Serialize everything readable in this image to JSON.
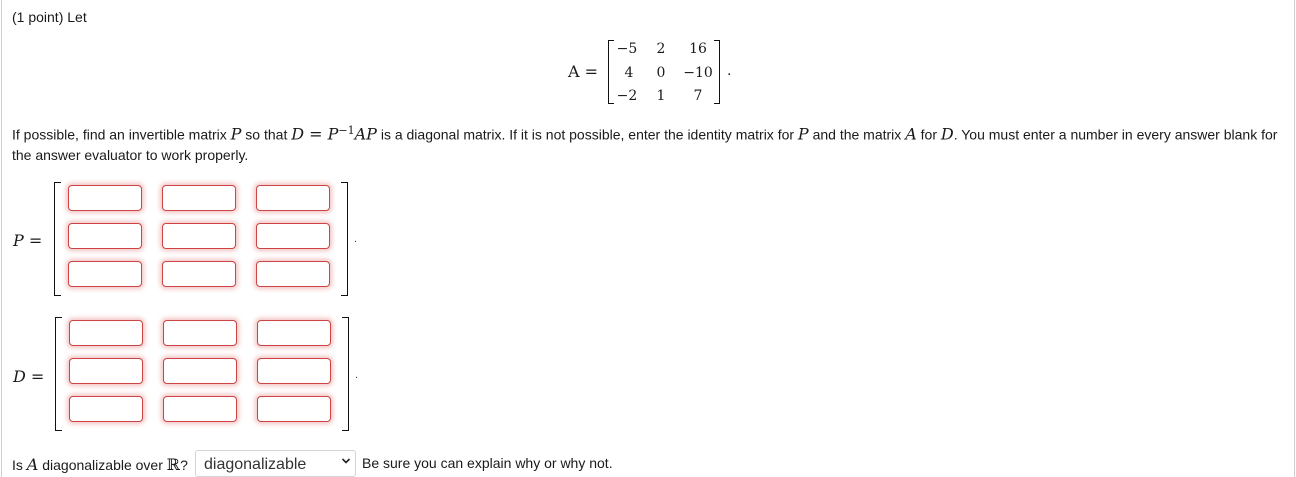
{
  "heading": "(1 point) Let",
  "matrix_a": {
    "label": "A =",
    "rows": [
      [
        "−5",
        "2",
        "16"
      ],
      [
        "4",
        "0",
        "−10"
      ],
      [
        "−2",
        "1",
        "7"
      ]
    ],
    "trailing": "."
  },
  "instruction": {
    "t1": "If possible, find an invertible matrix ",
    "P": "P",
    "t2": " so that ",
    "eq": "D = P",
    "sup": "−1",
    "ap": "AP",
    "t3": " is a diagonal matrix. If it is not possible, enter the identity matrix for ",
    "P2": "P",
    "t4": " and the matrix ",
    "A": "A",
    "t5": " for ",
    "D": "D",
    "t6": ". You must enter a number in every answer blank for the answer evaluator to work properly."
  },
  "p_matrix": {
    "label": "P =",
    "trailing": "."
  },
  "d_matrix": {
    "label": "D =",
    "trailing": "."
  },
  "question": {
    "t1": "Is ",
    "A": "A",
    "t2": " diagonalizable over ",
    "R": "ℝ",
    "t3": "?",
    "selected": "diagonalizable",
    "after": "Be sure you can explain why or why not."
  }
}
